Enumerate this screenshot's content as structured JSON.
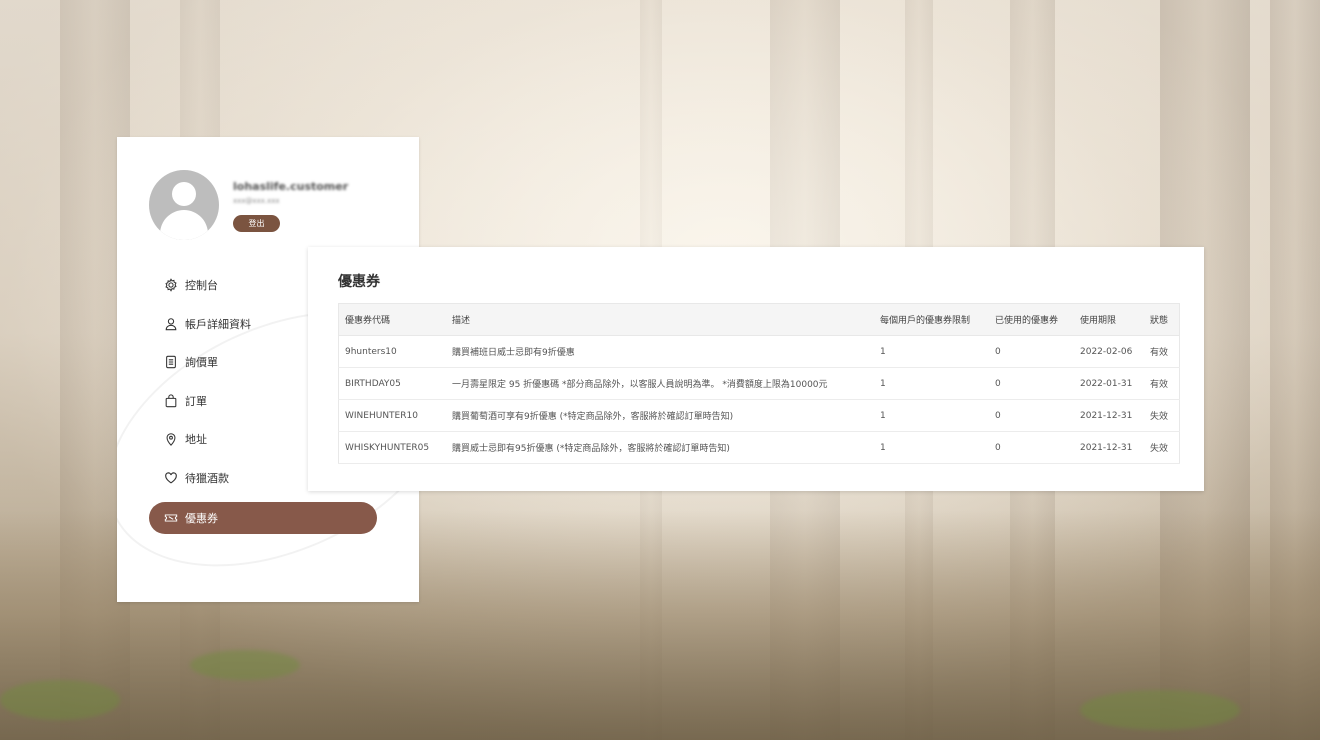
{
  "profile": {
    "username": "lohaslife.customer",
    "email": "xxx@xxx.xxx",
    "logout_label": "登出"
  },
  "menu": {
    "items": [
      {
        "label": "控制台",
        "icon": "gear-icon"
      },
      {
        "label": "帳戶詳細資料",
        "icon": "user-icon"
      },
      {
        "label": "詢價單",
        "icon": "document-icon"
      },
      {
        "label": "訂單",
        "icon": "bag-icon"
      },
      {
        "label": "地址",
        "icon": "location-pin-icon"
      },
      {
        "label": "待獵酒款",
        "icon": "heart-icon"
      },
      {
        "label": "優惠券",
        "icon": "coupon-icon",
        "active": true
      }
    ]
  },
  "coupons": {
    "title": "優惠券",
    "columns": [
      "優惠券代碼",
      "描述",
      "每個用戶的優惠券限制",
      "已使用的優惠券",
      "使用期限",
      "狀態"
    ],
    "rows": [
      [
        "9hunters10",
        "購買補班日威士忌即有9折優惠",
        "1",
        "0",
        "2022-02-06",
        "有效"
      ],
      [
        "BIRTHDAY05",
        "一月壽星限定 95 折優惠碼 *部分商品除外，以客服人員說明為準。 *消費額度上限為10000元",
        "1",
        "0",
        "2022-01-31",
        "有效"
      ],
      [
        "WINEHUNTER10",
        "購買葡萄酒可享有9折優惠 (*特定商品除外，客服將於確認訂單時告知)",
        "1",
        "0",
        "2021-12-31",
        "失效"
      ],
      [
        "WHISKYHUNTER05",
        "購買威士忌即有95折優惠 (*特定商品除外，客服將於確認訂單時告知)",
        "1",
        "0",
        "2021-12-31",
        "失效"
      ]
    ]
  },
  "colors": {
    "accent": "#87594a",
    "logout_button": "#7b5440"
  }
}
